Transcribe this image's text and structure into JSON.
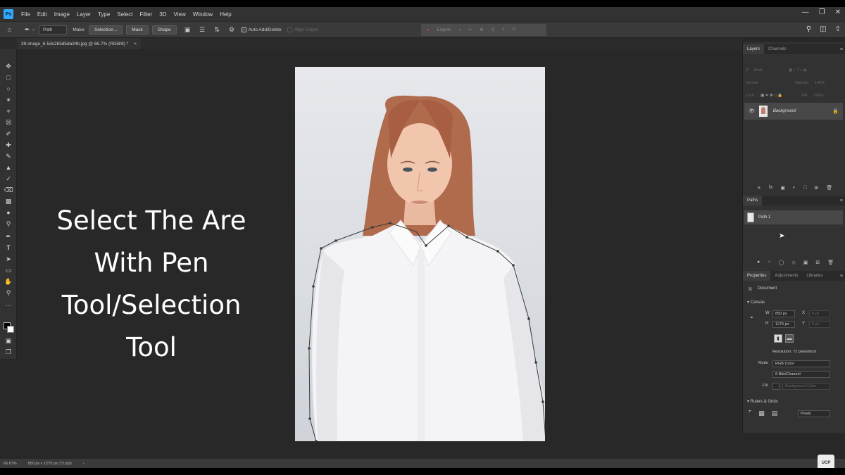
{
  "app": {
    "logo": "Ps"
  },
  "menu": [
    "File",
    "Edit",
    "Image",
    "Layer",
    "Type",
    "Select",
    "Filter",
    "3D",
    "View",
    "Window",
    "Help"
  ],
  "options": {
    "mode": "Path",
    "make_label": "Make:",
    "selection_button": "Selection...",
    "mask_button": "Mask",
    "shape_button": "Shape",
    "auto_add_delete": "Auto Add/Delete",
    "align_edges": "Align Edges",
    "recording_language": "English"
  },
  "document_tab": {
    "title": "39-image_6-5dc2b5d5da34b.jpg @ 66.7% (RGB/8) *"
  },
  "overlay": {
    "line1": "Select The Are",
    "line2": "With Pen",
    "line3": "Tool/Selection",
    "line4": "Tool"
  },
  "layers_panel": {
    "tabs": [
      "Layers",
      "Channels"
    ],
    "search_placeholder": "Kind",
    "blend_mode": "Normal",
    "opacity_label": "Opacity:",
    "opacity_value": "100%",
    "lock_label": "Lock:",
    "fill_label": "Fill:",
    "fill_value": "100%",
    "layer_name": "Background"
  },
  "paths_panel": {
    "tab": "Paths",
    "path_name": "Path 1"
  },
  "properties_panel": {
    "tabs": [
      "Properties",
      "Adjustments",
      "Libraries"
    ],
    "doc_label": "Document",
    "canvas_label": "Canvas",
    "width_label": "W",
    "width_value": "850 px",
    "height_label": "H",
    "height_value": "1275 px",
    "x_label": "X",
    "y_label": "Y",
    "x_value": "0 px",
    "y_value": "0 px",
    "resolution": "Resolution: 72 pixels/inch",
    "mode_label": "Mode",
    "mode_value": "RGB Color",
    "bits_value": "8 Bits/Channel",
    "fill_label": "Fill",
    "fill_value": "Background Color",
    "rulers_label": "Rulers & Grids",
    "units_value": "Pixels"
  },
  "status": {
    "zoom": "66.67%",
    "size": "850 px x 1275 px (72 ppi)"
  },
  "badge": "UCP",
  "colors": {
    "accent": "#31a8ff",
    "canvas_bg": "#282828",
    "panel_bg": "#323232"
  }
}
